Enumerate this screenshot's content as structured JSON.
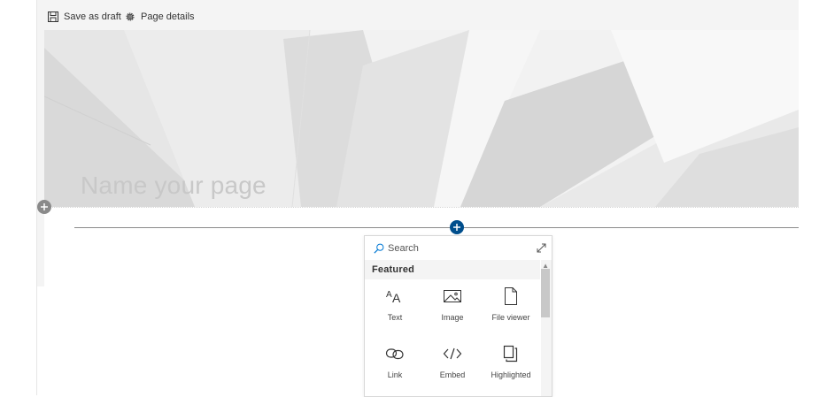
{
  "toolbar": {
    "save_label": "Save as draft",
    "details_label": "Page details"
  },
  "banner": {
    "title_placeholder": "Name your page"
  },
  "toolbox": {
    "search_placeholder": "Search",
    "section_label": "Featured",
    "items": [
      {
        "label": "Text",
        "icon": "text-icon"
      },
      {
        "label": "Image",
        "icon": "image-icon"
      },
      {
        "label": "File viewer",
        "icon": "file-icon"
      },
      {
        "label": "Link",
        "icon": "link-icon"
      },
      {
        "label": "Embed",
        "icon": "embed-icon"
      },
      {
        "label": "Highlighted",
        "icon": "highlighted-content-icon"
      }
    ]
  },
  "colors": {
    "accent": "#004e8c",
    "toolbar_bg": "#f4f4f4",
    "title_placeholder": "#c8c8c8"
  }
}
